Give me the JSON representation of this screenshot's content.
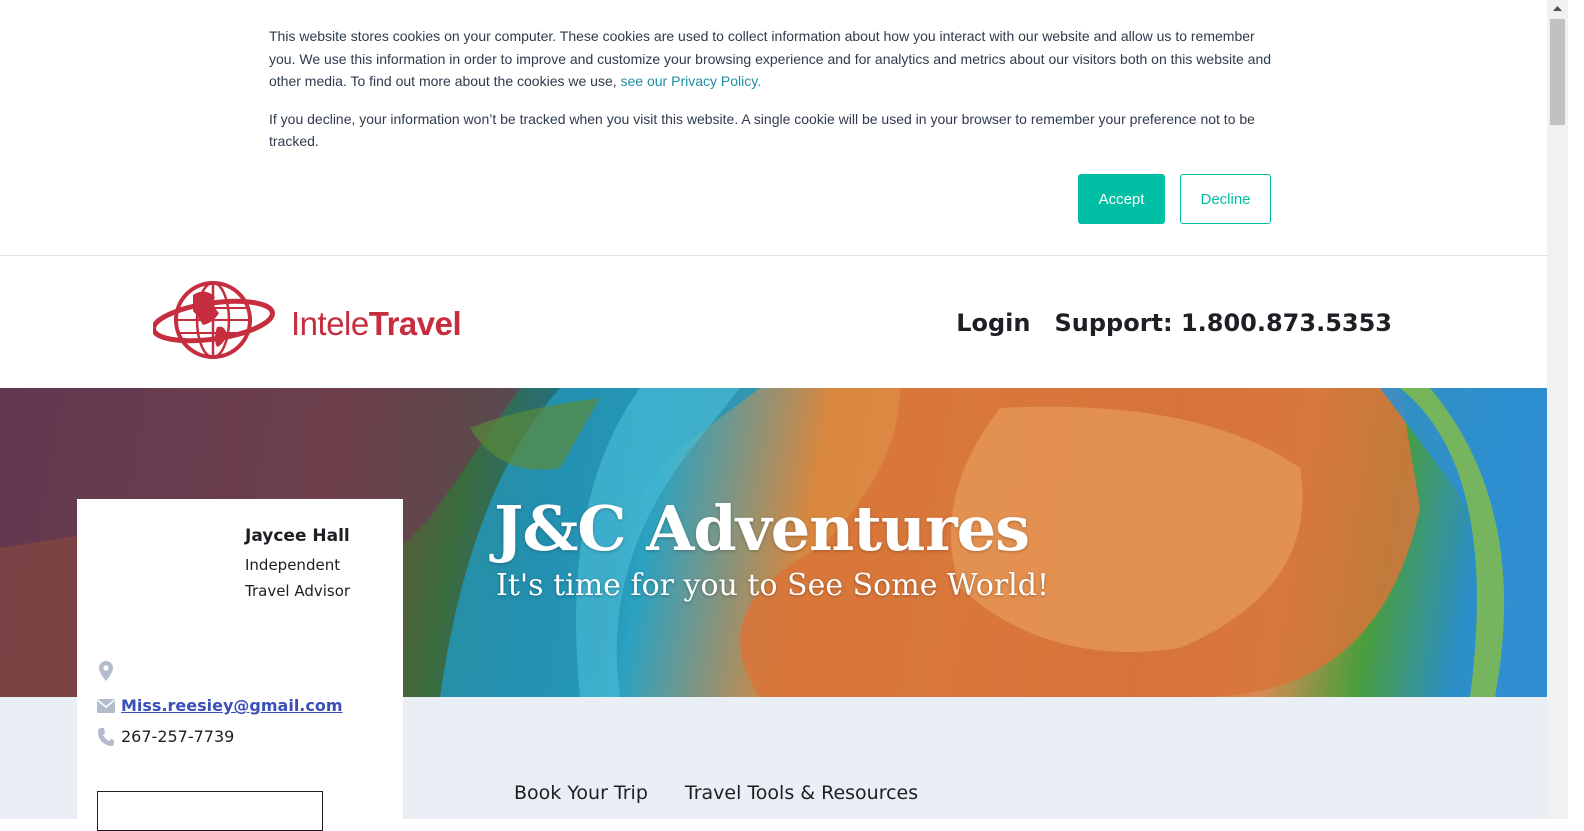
{
  "cookie_banner": {
    "paragraph1": "This website stores cookies on your computer. These cookies are used to collect information about how you interact with our website and allow us to remember you. We use this information in order to improve and customize your browsing experience and for analytics and metrics about our visitors both on this website and other media. To find out more about the cookies we use,",
    "privacy_link": "see our Privacy Policy.",
    "paragraph2": "If you decline, your information won’t be tracked when you visit this website. A single cookie will be used in your browser to remember your preference not to be tracked.",
    "accept_label": "Accept",
    "decline_label": "Decline",
    "accent_color": "#00bfa5"
  },
  "header": {
    "logo_text_light": "Intele",
    "logo_text_bold": "Travel",
    "logo_icon": "globe-icon",
    "brand_color": "#c62d3f",
    "login_label": "Login",
    "support_label": "Support: 1.800.873.5353"
  },
  "hero": {
    "title": "J&C Adventures",
    "subtitle": "It's time for you to See Some World!"
  },
  "advisor": {
    "name": "Jaycee Hall",
    "title": "Independent Travel Advisor",
    "location": "",
    "location_icon": "map-pin-icon",
    "email": "Miss.reesiey@gmail.com",
    "email_icon": "envelope-icon",
    "phone": "267-257-7739",
    "phone_icon": "phone-icon"
  },
  "nav": {
    "items": [
      {
        "label": "Book Your Trip"
      },
      {
        "label": "Travel Tools & Resources"
      }
    ]
  }
}
